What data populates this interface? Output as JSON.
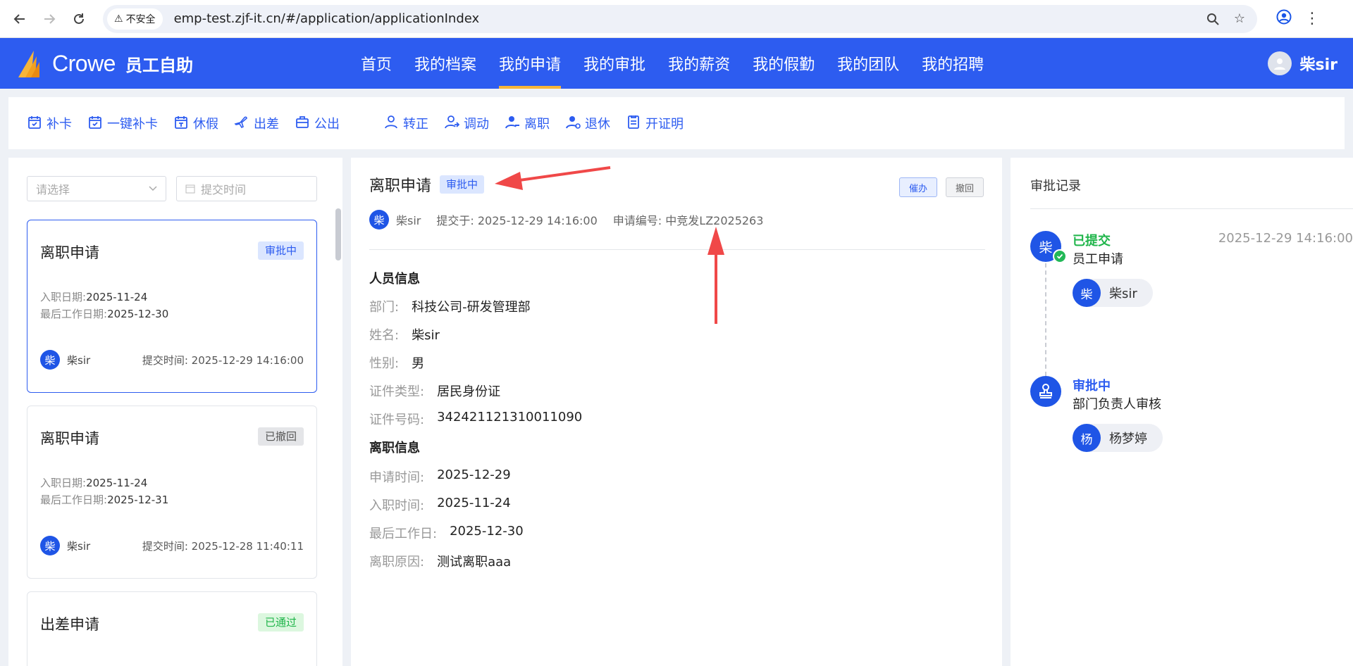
{
  "browser": {
    "security_label": "不安全",
    "url": "emp-test.zjf-it.cn/#/application/applicationIndex"
  },
  "app": {
    "brand_name": "Crowe",
    "brand_sub": "员工自助",
    "nav": [
      {
        "label": "首页",
        "active": false
      },
      {
        "label": "我的档案",
        "active": false
      },
      {
        "label": "我的申请",
        "active": true
      },
      {
        "label": "我的审批",
        "active": false
      },
      {
        "label": "我的薪资",
        "active": false
      },
      {
        "label": "我的假勤",
        "active": false
      },
      {
        "label": "我的团队",
        "active": false
      },
      {
        "label": "我的招聘",
        "active": false
      }
    ],
    "user_name": "柴sir",
    "accent": "#2d5cf0",
    "nav_indicator": "#f6b53a"
  },
  "quick_actions": [
    {
      "label": "补卡",
      "icon": "calendar-check-icon"
    },
    {
      "label": "一键补卡",
      "icon": "calendar-check-icon"
    },
    {
      "label": "休假",
      "icon": "calendar-leave-icon"
    },
    {
      "label": "出差",
      "icon": "plane-icon"
    },
    {
      "label": "公出",
      "icon": "briefcase-icon"
    },
    {
      "label": "转正",
      "icon": "user-icon"
    },
    {
      "label": "调动",
      "icon": "user-transfer-icon"
    },
    {
      "label": "离职",
      "icon": "user-leave-icon"
    },
    {
      "label": "退休",
      "icon": "user-retire-icon"
    },
    {
      "label": "开证明",
      "icon": "document-icon"
    }
  ],
  "left": {
    "filter_placeholder": "请选择",
    "date_placeholder": "提交时间",
    "cards": [
      {
        "title": "离职申请",
        "status": "审批中",
        "line1_label": "入职日期:",
        "line1_value": "2025-11-24",
        "line2_label": "最后工作日期:",
        "line2_value": "2025-12-30",
        "avatar": "柴",
        "user": "柴sir",
        "time": "提交时间:  2025-12-29 14:16:00"
      },
      {
        "title": "离职申请",
        "status": "已撤回",
        "line1_label": "入职日期:",
        "line1_value": "2025-11-24",
        "line2_label": "最后工作日期:",
        "line2_value": "2025-12-31",
        "avatar": "柴",
        "user": "柴sir",
        "time": "提交时间:  2025-12-28 11:40:11"
      },
      {
        "title": "出差申请",
        "status": "已通过"
      }
    ]
  },
  "detail": {
    "title": "离职申请",
    "status": "审批中",
    "urge_label": "催办",
    "revoke_label": "撤回",
    "avatar": "柴",
    "applicant": "柴sir",
    "submitted": "提交于:  2025-12-29 14:16:00",
    "app_no": "申请编号:  中竞发LZ2025263",
    "section_person": "人员信息",
    "person": [
      {
        "k": "部门:",
        "v": "科技公司-研发管理部"
      },
      {
        "k": "姓名:",
        "v": "柴sir"
      },
      {
        "k": "性别:",
        "v": "男"
      },
      {
        "k": "证件类型:",
        "v": "居民身份证"
      },
      {
        "k": "证件号码:",
        "v": "342421121310011090"
      }
    ],
    "section_leave": "离职信息",
    "leave": [
      {
        "k": "申请时间:",
        "v": "2025-12-29"
      },
      {
        "k": "入职时间:",
        "v": "2025-11-24"
      },
      {
        "k": "最后工作日:",
        "v": "2025-12-30"
      },
      {
        "k": "离职原因:",
        "v": "测试离职aaa"
      }
    ]
  },
  "approval": {
    "title": "审批记录",
    "steps": [
      {
        "status": "已提交",
        "status_color": "#1fb54a",
        "desc": "员工申请",
        "time": "2025-12-29 14:16:00",
        "node": "柴",
        "person_avatar": "柴",
        "person": "柴sir"
      },
      {
        "status": "审批中",
        "status_color": "#2d5cf0",
        "desc": "部门负责人审核",
        "node_icon": "stamp-icon",
        "person_avatar": "杨",
        "person": "杨梦婷"
      }
    ]
  }
}
